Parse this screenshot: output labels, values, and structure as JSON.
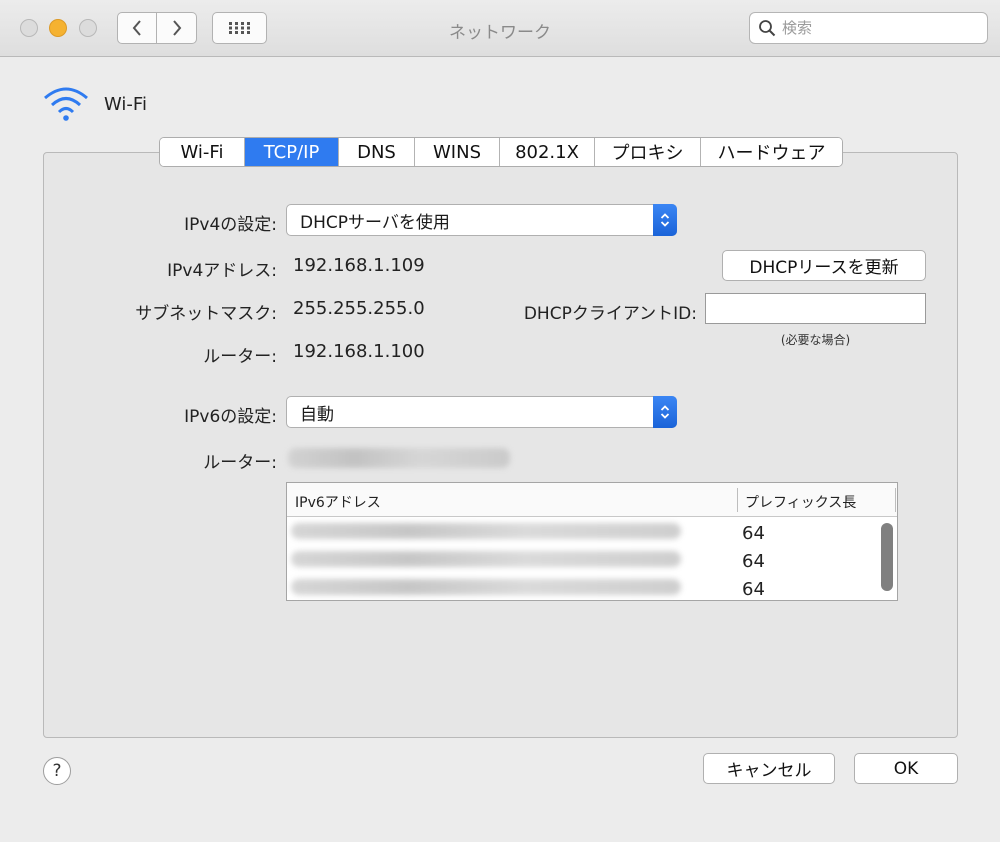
{
  "window": {
    "title": "ネットワーク",
    "search_placeholder": "検索",
    "toolbar_icons": [
      "back-icon",
      "forward-icon",
      "show-all-grid-icon"
    ]
  },
  "header": {
    "interface_label": "Wi-Fi",
    "icon": "wifi-icon",
    "accent": "#2f7bf0"
  },
  "tabs": [
    {
      "label": "Wi-Fi",
      "active": false
    },
    {
      "label": "TCP/IP",
      "active": true
    },
    {
      "label": "DNS",
      "active": false
    },
    {
      "label": "WINS",
      "active": false
    },
    {
      "label": "802.1X",
      "active": false
    },
    {
      "label": "プロキシ",
      "active": false
    },
    {
      "label": "ハードウェア",
      "active": false
    }
  ],
  "ipv4": {
    "config_label": "IPv4の設定:",
    "config_value": "DHCPサーバを使用",
    "address_label": "IPv4アドレス:",
    "address_value": "192.168.1.109",
    "subnet_label": "サブネットマスク:",
    "subnet_value": "255.255.255.0",
    "router_label": "ルーター:",
    "router_value": "192.168.1.100",
    "renew_button": "DHCPリースを更新",
    "client_id_label": "DHCPクライアントID:",
    "client_id_value": "",
    "client_id_hint": "(必要な場合)"
  },
  "ipv6": {
    "config_label": "IPv6の設定:",
    "config_value": "自動",
    "router_label": "ルーター:",
    "table": {
      "col_address": "IPv6アドレス",
      "col_prefix": "プレフィックス長",
      "rows": [
        {
          "prefix": "64"
        },
        {
          "prefix": "64"
        },
        {
          "prefix": "64"
        }
      ]
    }
  },
  "footer": {
    "help": "?",
    "cancel": "キャンセル",
    "ok": "OK"
  }
}
